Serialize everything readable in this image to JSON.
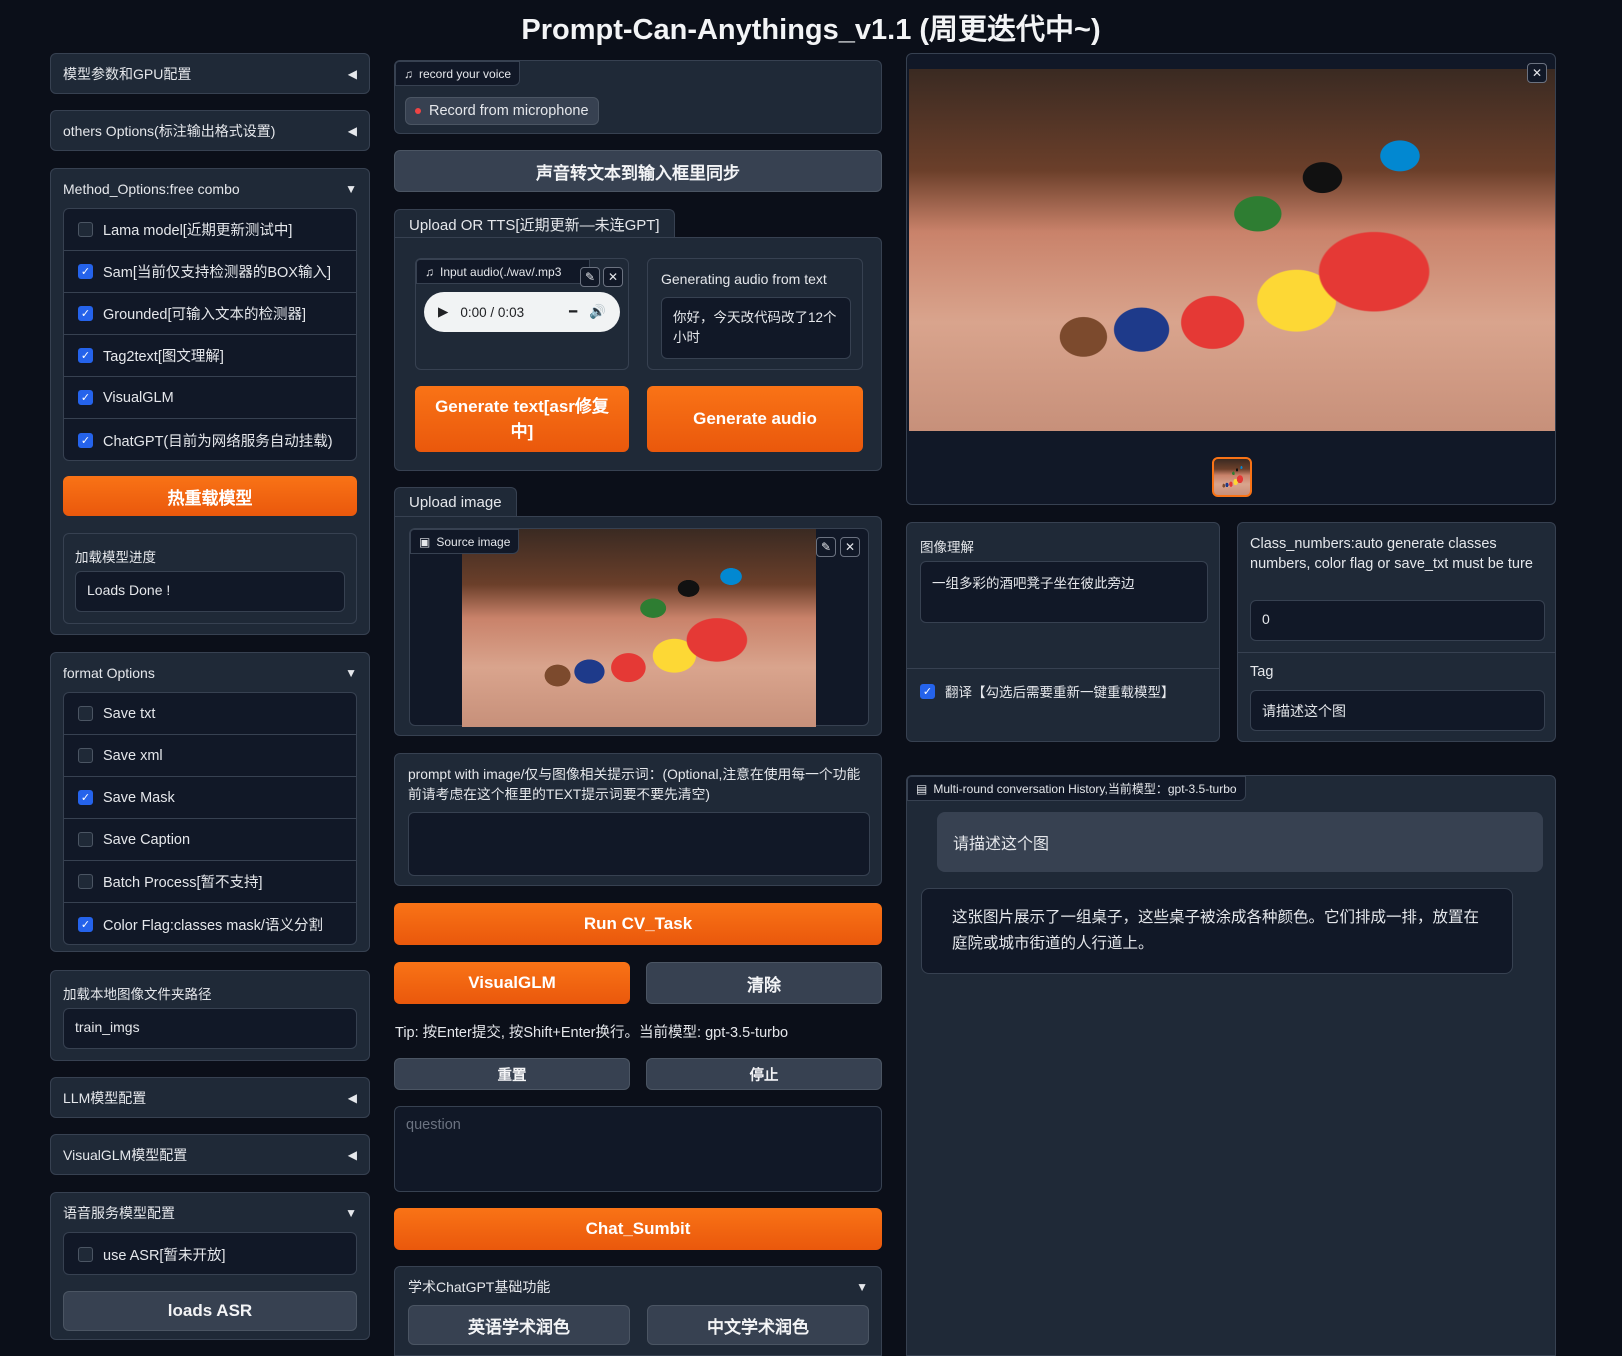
{
  "title": "Prompt-Can-Anythings_v1.1 (周更迭代中~)",
  "left": {
    "acc_gpu": "模型参数和GPU配置",
    "acc_others": "others Options(标注输出格式设置)",
    "method": {
      "title": "Method_Options:free combo",
      "items": [
        {
          "label": "Lama model[近期更新测试中]",
          "checked": false
        },
        {
          "label": "Sam[当前仅支持检测器的BOX输入]",
          "checked": true
        },
        {
          "label": "Grounded[可输入文本的检测器]",
          "checked": true
        },
        {
          "label": "Tag2text[图文理解]",
          "checked": true
        },
        {
          "label": "VisualGLM",
          "checked": true
        },
        {
          "label": "ChatGPT(目前为网络服务自动挂载)",
          "checked": true
        }
      ],
      "reload_button": "热重载模型",
      "progress_label": "加载模型进度",
      "progress_value": "Loads Done !"
    },
    "format": {
      "title": "format Options",
      "items": [
        {
          "label": "Save txt",
          "checked": false
        },
        {
          "label": "Save xml",
          "checked": false
        },
        {
          "label": "Save Mask",
          "checked": true
        },
        {
          "label": "Save Caption",
          "checked": false
        },
        {
          "label": "Batch Process[暂不支持]",
          "checked": false
        },
        {
          "label": "Color Flag:classes mask/语义分割",
          "checked": true
        }
      ]
    },
    "folder": {
      "label": "加载本地图像文件夹路径",
      "value": "train_imgs"
    },
    "acc_llm": "LLM模型配置",
    "acc_visualglm": "VisualGLM模型配置",
    "speech": {
      "title": "语音服务模型配置",
      "asr_label": "use ASR[暂未开放]",
      "asr_checked": false,
      "load_button": "loads ASR"
    }
  },
  "middle": {
    "voice_tag": "record your voice",
    "record_button": "Record from microphone",
    "sync_button": "声音转文本到输入框里同步",
    "upload_tab": "Upload OR TTS[近期更新—未连GPT]",
    "audio_tag": "Input audio(./wav/.mp3",
    "audio_time": "0:00 / 0:03",
    "tts_label": "Generating audio from text",
    "tts_value": "你好，今天改代码改了12个小时",
    "gen_text_button": "Generate text[asr修复中]",
    "gen_audio_button": "Generate audio",
    "image_tab": "Upload image",
    "source_tag": "Source image",
    "prompt_label": "prompt with image/仅与图像相关提示词：(Optional,注意在使用每一个功能前请考虑在这个框里的TEXT提示词要不要先清空)",
    "prompt_value": "",
    "run_button": "Run CV_Task",
    "visualglm_button": "VisualGLM",
    "clear_button": "清除",
    "tip": "Tip: 按Enter提交, 按Shift+Enter换行。当前模型: gpt-3.5-turbo",
    "reset_button": "重置",
    "stop_button": "停止",
    "question_placeholder": "question",
    "submit_button": "Chat_Sumbit",
    "academic": {
      "title": "学术ChatGPT基础功能",
      "en_button": "英语学术润色",
      "zh_button": "中文学术润色"
    }
  },
  "right": {
    "understanding_label": "图像理解",
    "understanding_value": "一组多彩的酒吧凳子坐在彼此旁边",
    "translate_label": "翻译【勾选后需要重新一键重载模型】",
    "translate_checked": true,
    "class_label": "Class_numbers:auto generate classes numbers, color flag or save_txt must be ture",
    "class_value": "0",
    "tag_label": "Tag",
    "tag_value": "请描述这个图",
    "history_tag": "Multi-round conversation History,当前模型：gpt-3.5-turbo",
    "chat": [
      {
        "role": "user",
        "text": "请描述这个图"
      },
      {
        "role": "bot",
        "text": "这张图片展示了一组桌子，这些桌子被涂成各种颜色。它们排成一排，放置在庭院或城市街道的人行道上。"
      }
    ]
  },
  "colors": {
    "accent": "#f97316",
    "background": "#0b0f19",
    "panel": "#1f2937",
    "checkbox": "#2563eb"
  }
}
